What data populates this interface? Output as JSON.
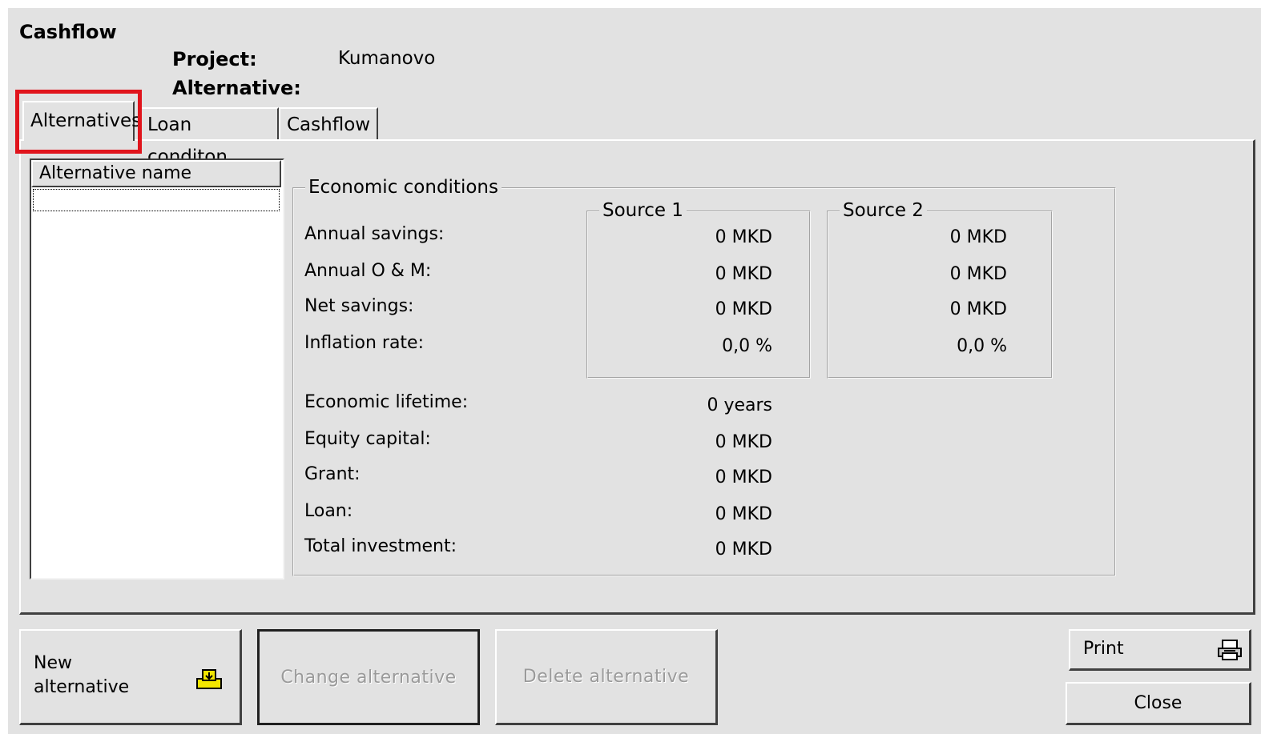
{
  "window": {
    "title": "Cashflow"
  },
  "header": {
    "project_label": "Project:",
    "project_value": "Kumanovo",
    "alternative_label": "Alternative:"
  },
  "tabs": [
    {
      "label": "Alternatives",
      "active": true
    },
    {
      "label": "Loan conditon",
      "active": false
    },
    {
      "label": "Cashflow",
      "active": false
    }
  ],
  "alternatives_list": {
    "header": "Alternative name",
    "rows": []
  },
  "economic": {
    "title": "Economic conditions",
    "source1_title": "Source 1",
    "source2_title": "Source 2",
    "rows": [
      {
        "label": "Annual savings:",
        "s1": "0 MKD",
        "s2": "0 MKD"
      },
      {
        "label": "Annual O & M:",
        "s1": "0 MKD",
        "s2": "0 MKD"
      },
      {
        "label": "Net savings:",
        "s1": "0 MKD",
        "s2": "0 MKD"
      },
      {
        "label": "Inflation rate:",
        "s1": "0,0 %",
        "s2": "0,0 %"
      }
    ],
    "totals": [
      {
        "label": "Economic lifetime:",
        "value": "0 years"
      },
      {
        "label": "Equity capital:",
        "value": "0 MKD"
      },
      {
        "label": "Grant:",
        "value": "0 MKD"
      },
      {
        "label": "Loan:",
        "value": "0 MKD"
      },
      {
        "label": "Total investment:",
        "value": "0 MKD"
      }
    ]
  },
  "buttons": {
    "new_line1": "New",
    "new_line2": "alternative",
    "new_icon": "add-record-icon",
    "change": "Change alternative",
    "delete": "Delete alternative",
    "print": "Print",
    "print_icon": "printer-icon",
    "close": "Close"
  },
  "colors": {
    "background": "#e2e2e2",
    "highlight": "#e0141c"
  }
}
